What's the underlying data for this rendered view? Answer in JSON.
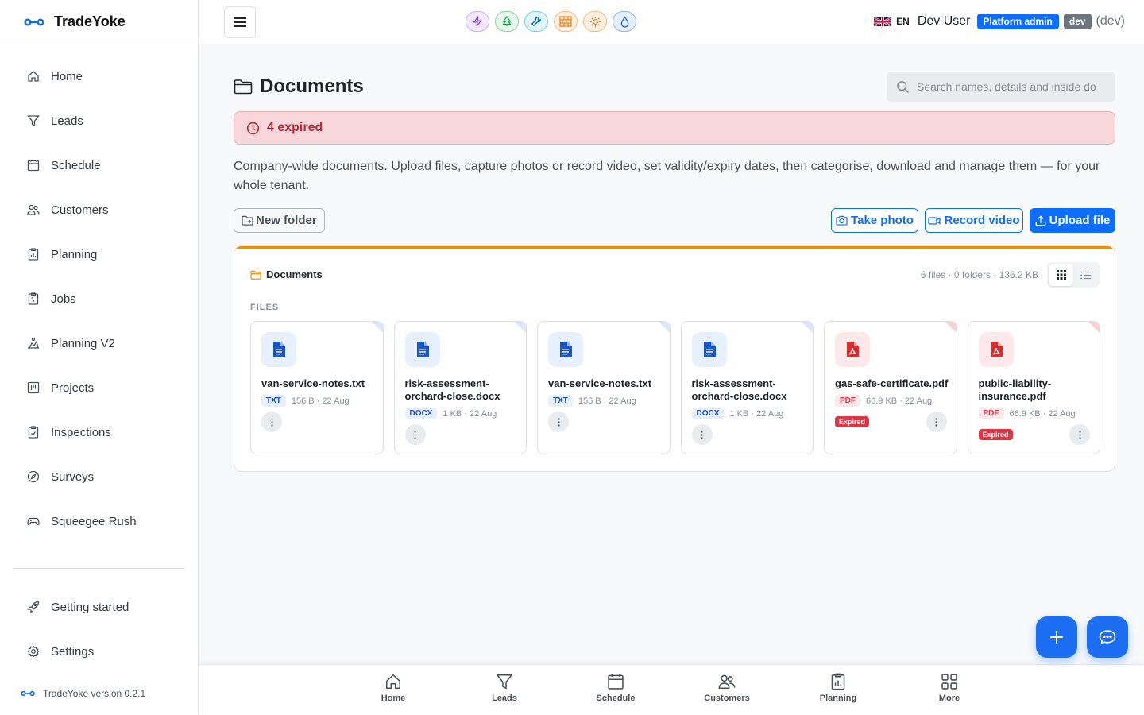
{
  "app": {
    "name": "TradeYoke",
    "version_text": "TradeYoke version 0.2.1"
  },
  "sidebar": {
    "items": [
      {
        "label": "Home",
        "icon": "home-icon"
      },
      {
        "label": "Leads",
        "icon": "filter-icon"
      },
      {
        "label": "Schedule",
        "icon": "calendar-icon"
      },
      {
        "label": "Customers",
        "icon": "users-icon"
      },
      {
        "label": "Planning",
        "icon": "clipboard-chart-icon"
      },
      {
        "label": "Jobs",
        "icon": "clipboard-icon"
      },
      {
        "label": "Planning V2",
        "icon": "planning-v2-icon"
      },
      {
        "label": "Projects",
        "icon": "kanban-icon"
      },
      {
        "label": "Inspections",
        "icon": "clipboard-check-icon"
      },
      {
        "label": "Surveys",
        "icon": "compass-icon"
      },
      {
        "label": "Squeegee Rush",
        "icon": "gamepad-icon"
      }
    ],
    "bottom_items": [
      {
        "label": "Getting started",
        "icon": "rocket-icon"
      },
      {
        "label": "Settings",
        "icon": "gear-icon"
      }
    ]
  },
  "topbar": {
    "quick_icons": [
      {
        "name": "lightning-icon",
        "color": "#7c3aed",
        "bg": "#f3e8ff"
      },
      {
        "name": "tree-icon",
        "color": "#16a34a",
        "bg": "#e6f7ec"
      },
      {
        "name": "wrench-icon",
        "color": "#0e7490",
        "bg": "#e0f5f8"
      },
      {
        "name": "brick-wall-icon",
        "color": "#ea7a0c",
        "bg": "#fdf0e2"
      },
      {
        "name": "sun-icon",
        "color": "#ea7a0c",
        "bg": "#fdf0e2"
      },
      {
        "name": "droplet-icon",
        "color": "#2563eb",
        "bg": "#e6effd"
      }
    ],
    "language": "EN",
    "user_name": "Dev User",
    "role_badge": "Platform admin",
    "env_badge": "dev",
    "env_text": "(dev)"
  },
  "page": {
    "title": "Documents",
    "search_placeholder": "Search names, details and inside documents",
    "alert_text": "4 expired",
    "description": "Company-wide documents. Upload files, capture photos or record video, set validity/expiry dates, then categorise, download and manage them — for your whole tenant.",
    "buttons": {
      "new_folder": "New folder",
      "take_photo": "Take photo",
      "record_video": "Record video",
      "upload_file": "Upload file"
    }
  },
  "browser": {
    "accent_color": "#f08c00",
    "breadcrumb": "Documents",
    "stats": "6 files · 0 folders · 136.2 KB",
    "view_mode": "grid",
    "section_label": "FILES",
    "files": [
      {
        "name": "van-service-notes.txt",
        "ext": "TXT",
        "size": "156 B",
        "date": "22 Aug",
        "kind": "doc",
        "expired": false
      },
      {
        "name": "risk-assessment-orchard-close.docx",
        "ext": "DOCX",
        "size": "1 KB",
        "date": "22 Aug",
        "kind": "doc",
        "expired": false
      },
      {
        "name": "van-service-notes.txt",
        "ext": "TXT",
        "size": "156 B",
        "date": "22 Aug",
        "kind": "doc",
        "expired": false
      },
      {
        "name": "risk-assessment-orchard-close.docx",
        "ext": "DOCX",
        "size": "1 KB",
        "date": "22 Aug",
        "kind": "doc",
        "expired": false
      },
      {
        "name": "gas-safe-certificate.pdf",
        "ext": "PDF",
        "size": "66.9 KB",
        "date": "22 Aug",
        "kind": "pdf",
        "expired": true
      },
      {
        "name": "public-liability-insurance.pdf",
        "ext": "PDF",
        "size": "66.9 KB",
        "date": "22 Aug",
        "kind": "pdf",
        "expired": true
      }
    ],
    "expired_label": "Expired"
  },
  "bottom_nav": [
    {
      "label": "Home",
      "icon": "home-icon"
    },
    {
      "label": "Leads",
      "icon": "filter-icon"
    },
    {
      "label": "Schedule",
      "icon": "calendar-icon"
    },
    {
      "label": "Customers",
      "icon": "users-icon"
    },
    {
      "label": "Planning",
      "icon": "clipboard-chart-icon"
    },
    {
      "label": "More",
      "icon": "grid-icon"
    }
  ],
  "fabs": {
    "add": "plus-icon",
    "chat": "chat-icon"
  }
}
